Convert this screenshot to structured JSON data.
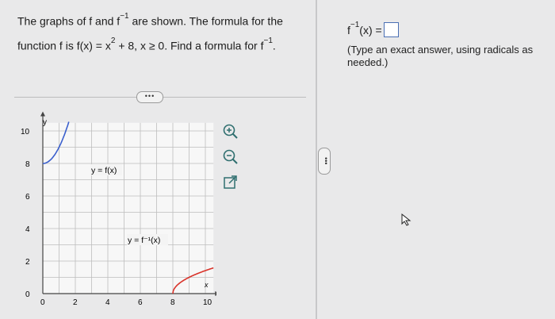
{
  "question": {
    "line1_pre": "The graphs of f and f",
    "inv": "−1",
    "line1_post": " are shown. The formula for the",
    "line2_pre": "function f is f(x) = x",
    "exp2": "2",
    "line2_mid": " + 8, x ≥ 0. Find a formula for f",
    "inv2": "−1",
    "line2_post": "."
  },
  "more_label": "•••",
  "graph": {
    "y_axis_label": "y",
    "x_axis_label": "x",
    "x_ticks": [
      "0",
      "2",
      "4",
      "6",
      "8",
      "10"
    ],
    "y_ticks": [
      "0",
      "2",
      "4",
      "6",
      "8",
      "10"
    ],
    "curve_f_label": "y = f(x)",
    "curve_finv_label": "y = f⁻¹(x)",
    "colors": {
      "f": "#3a5fcd",
      "finv": "#d9342b",
      "grid": "#bdbdbd",
      "axis": "#444444"
    }
  },
  "tools": {
    "zoom_in": "zoom-in-icon",
    "zoom_out": "zoom-out-icon",
    "popout": "popout-icon"
  },
  "answer": {
    "label_pre": "f",
    "label_exp": "−1",
    "label_post": "(x) ="
  },
  "hint": "(Type an exact answer, using radicals as needed.)"
}
